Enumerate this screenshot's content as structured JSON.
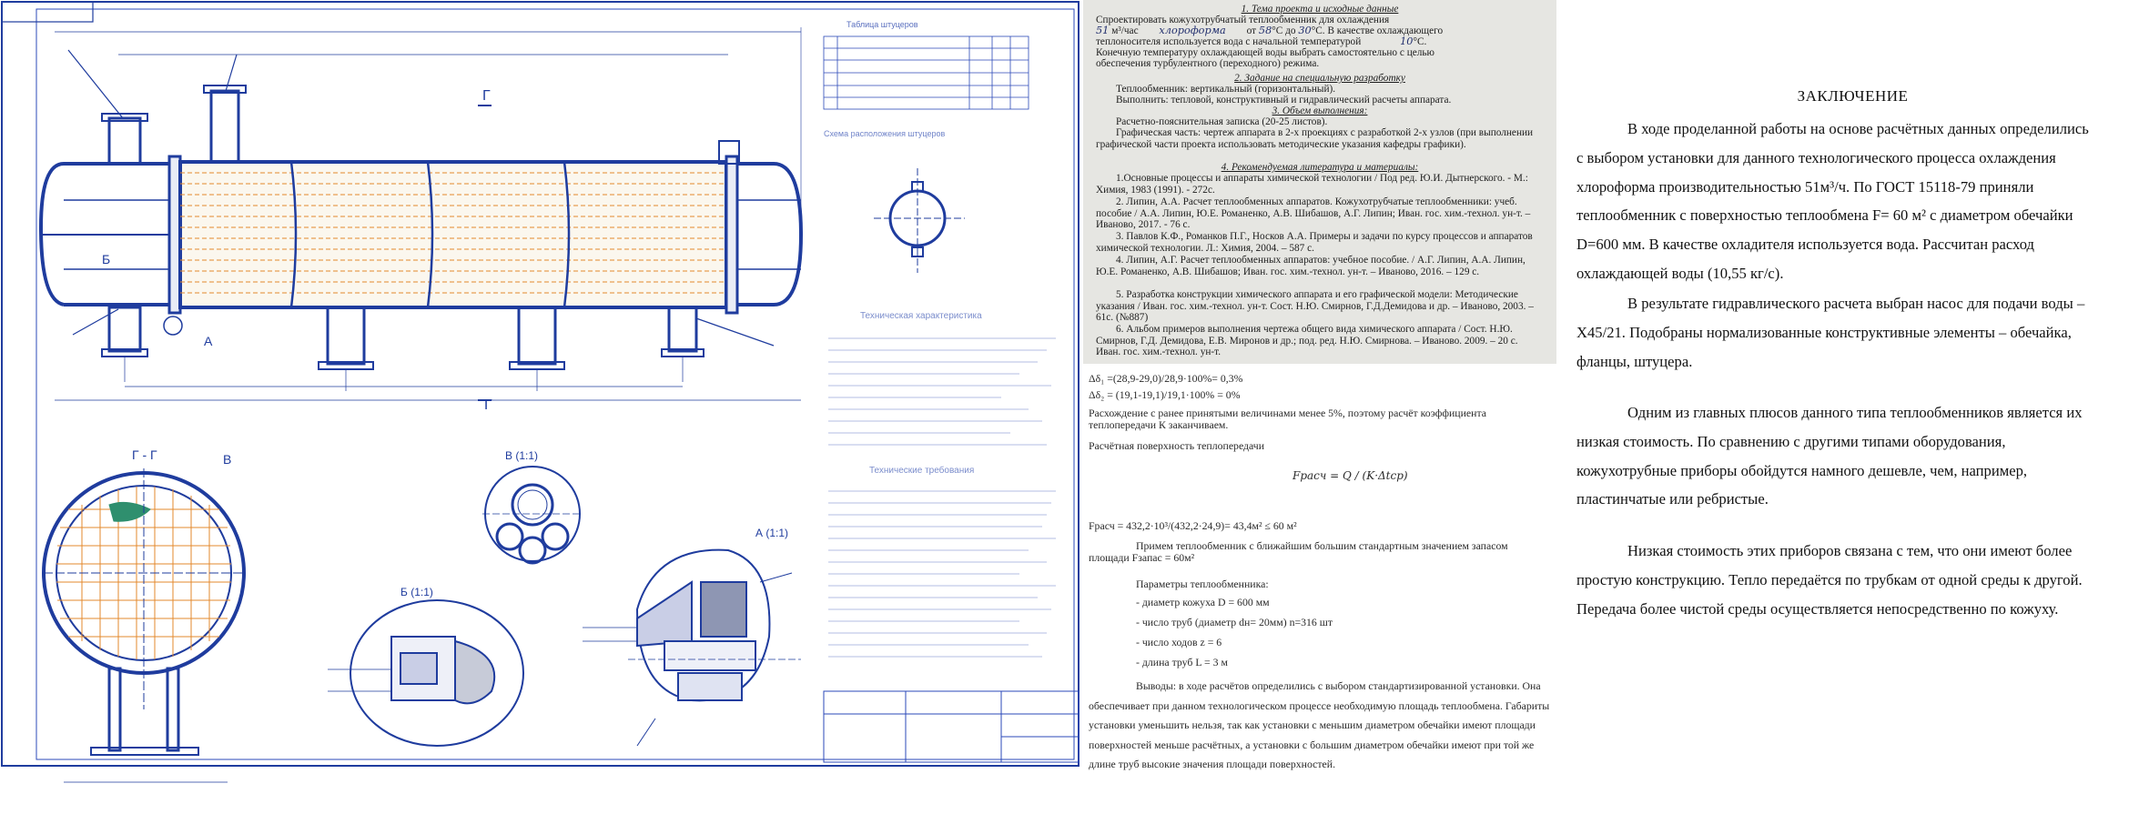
{
  "drawing": {
    "section_mark_top": "Г",
    "section_mark_bottom": "Г",
    "label_b": "Б",
    "label_a": "А",
    "label_g_section": "Г - Г",
    "label_v": "В",
    "label_v_view": "В (1:1)",
    "label_b_view": "Б (1:1)",
    "label_a_view": "А (1:1)",
    "table_title": "Таблица штуцеров",
    "scheme_title": "Схема расположения штуцеров",
    "tech_char_title": "Техническая характеристика",
    "tech_req_title": "Технические требования"
  },
  "assignment": {
    "heading1": "1. Тема проекта и исходные данные",
    "line1": "Спроектировать кожухотрубчатый теплообменник для охлаждения",
    "flow_value": "51",
    "line2a": "м³/час",
    "substance": "хлороформа",
    "line2b": "от",
    "t_from": "58",
    "line2c": "°С до",
    "t_to": "30",
    "line2d": "°С. В качестве охлаждающего",
    "line3": "теплоносителя используется вода с начальной температурой",
    "t_water": "10",
    "line3b": "°С.",
    "line4": "Конечную температуру охлаждающей воды выбрать самостоятельно с целью",
    "line5": "обеспечения турбулентного (переходного) режима.",
    "heading2": "2. Задание на специальную разработку",
    "line6": "Теплообменник: вертикальный (горизонтальный).",
    "line7": "Выполнить: тепловой, конструктивный и гидравлический расчеты аппарата.",
    "heading3": "3. Объем выполнения:",
    "line8": "Расчетно-пояснительная записка (20-25 листов).",
    "line9": "Графическая часть: чертеж аппарата в 2-х проекциях с разработкой 2-х узлов (при выполнении графической части проекта использовать методические указания кафедры графики).",
    "heading4": "4. Рекомендуемая литература и материалы:",
    "ref1": "1.Основные процессы и аппараты химической технологии / Под ред. Ю.И. Дытнерского. - М.: Химия, 1983 (1991). - 272с.",
    "ref2": "2. Липин, А.А. Расчет теплообменных аппаратов. Кожухотрубчатые теплообменники: учеб. пособие / А.А. Липин, Ю.Е. Романенко, А.В. Шибашов, А.Г. Липин; Иван. гос. хим.-технол. ун-т. – Иваново, 2017. - 76 с.",
    "ref3": "3. Павлов К.Ф., Романков П.Г., Носков А.А. Примеры и задачи по курсу процессов и аппаратов химической технологии. Л.: Химия, 2004. – 587 с.",
    "ref4": "4. Липин, А.Г. Расчет теплообменных аппаратов: учебное пособие. / А.Г. Липин, А.А. Липин, Ю.Е. Романенко, А.В. Шибашов; Иван. гос. хим.-технол. ун-т. – Иваново, 2016. – 129 с.",
    "ref5": "5. Разработка конструкции химического аппарата и его графической модели: Методические указания / Иван. гос. хим.-технол. ун-т. Сост. Н.Ю. Смирнов, Г.Д.Демидова и др. – Иваново, 2003. – 61с. (№887)",
    "ref6": "6. Альбом примеров выполнения чертежа общего вида химического аппарата / Сост. Н.Ю. Смирнов, Г.Д. Демидова, Е.В. Миронов и др.; под. ред. Н.Ю. Смирнова. – Иваново. 2009. – 20 с. Иван. гос. хим.-технол. ун-т."
  },
  "calc": {
    "delta1": "Δδ₁ =(28,9-29,0)/28,9·100%= 0,3%",
    "delta2": "Δδ₂ = (19,1-19,1)/19,1·100% = 0%",
    "line_discrepancy": "Расхождение с ранее принятыми величинами менее 5%, поэтому расчёт коэффициента теплопередачи К заканчиваем.",
    "line_area": "Расчётная поверхность теплопередачи",
    "formula": "Fрасч = Q / (K·Δtср)",
    "area_result": "Fрасч = 432,2·10³/(432,2·24,9)= 43,4м² ≤ 60 м²",
    "accept1": "Примем теплообменник с ближайшим большим стандартным значением запасом площади Fзапас = 60м²",
    "params_title": "Параметры теплообменника:",
    "p1": "- диаметр кожуха D = 600 мм",
    "p2": "- число труб (диаметр dн= 20мм) n=316 шт",
    "p3": "- число ходов   z = 6",
    "p4": "- длина труб   L = 3 м",
    "conclusions": "Выводы: в ходе расчётов определились с выбором стандартизированной установки. Она обеспечивает при данном технологическом процессе необходимую площадь теплообмена. Габариты установки уменьшить нельзя, так как установки с меньшим диаметром обечайки имеют площади поверхностей меньше расчётных, а установки с большим диаметром обечайки имеют при той же длине труб высокие значения площади поверхностей."
  },
  "conclusion": {
    "title": "ЗАКЛЮЧЕНИЕ",
    "p1": "В ходе проделанной работы на основе расчётных данных определились с выбором установки для данного технологического процесса охлаждения хлороформа производительностью 51м³/ч. По ГОСТ 15118-79 приняли теплообменник с поверхностью теплообмена F= 60 м² с диаметром обечайки D=600 мм. В качестве охладителя используется вода. Рассчитан расход охлаждающей воды (10,55 кг/с).",
    "p2": "В результате гидравлического расчета выбран насос для подачи воды –Х45/21. Подобраны нормализованные конструктивные элементы – обечайка, фланцы, штуцера.",
    "p3": "Одним из главных плюсов данного типа теплообменников является их низкая стоимость. По сравнению с другими типами оборудования, кожухотрубные приборы обойдутся намного дешевле, чем, например, пластинчатые или ребристые.",
    "p4": "Низкая стоимость этих приборов связана с тем, что они имеют более простую конструкцию. Тепло передаётся по трубкам от одной среды к другой. Передача более чистой среды осуществляется непосредственно по кожуху."
  }
}
